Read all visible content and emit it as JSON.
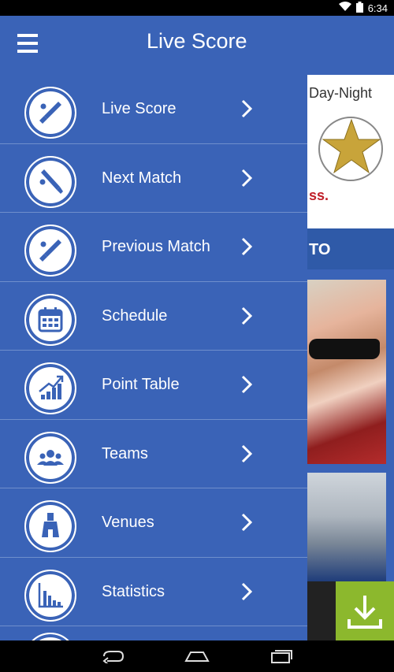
{
  "status_bar": {
    "time": "6:34",
    "wifi_icon": "wifi-icon",
    "battery_icon": "battery-icon"
  },
  "app_bar": {
    "title": "Live Score",
    "menu_icon": "hamburger-menu-icon"
  },
  "menu": {
    "items": [
      {
        "label": "Live Score",
        "icon": "cricket-bat-icon"
      },
      {
        "label": "Next Match",
        "icon": "cricket-bat-icon"
      },
      {
        "label": "Previous Match",
        "icon": "cricket-bat-icon"
      },
      {
        "label": "Schedule",
        "icon": "calendar-icon"
      },
      {
        "label": "Point Table",
        "icon": "growth-chart-icon"
      },
      {
        "label": "Teams",
        "icon": "team-icon"
      },
      {
        "label": "Venues",
        "icon": "stadium-icon"
      },
      {
        "label": "Statistics",
        "icon": "bar-chart-icon"
      }
    ]
  },
  "background": {
    "day_night": "Day-Night",
    "ss_text": "ss.",
    "to_text": "TO"
  },
  "nav_bar": {
    "back_icon": "back-icon",
    "home_icon": "home-icon",
    "recents_icon": "recents-icon"
  },
  "colors": {
    "drawer_bg": "#3a63b7",
    "divider": "#6f8fcc",
    "download_bg": "#8cb82d"
  }
}
